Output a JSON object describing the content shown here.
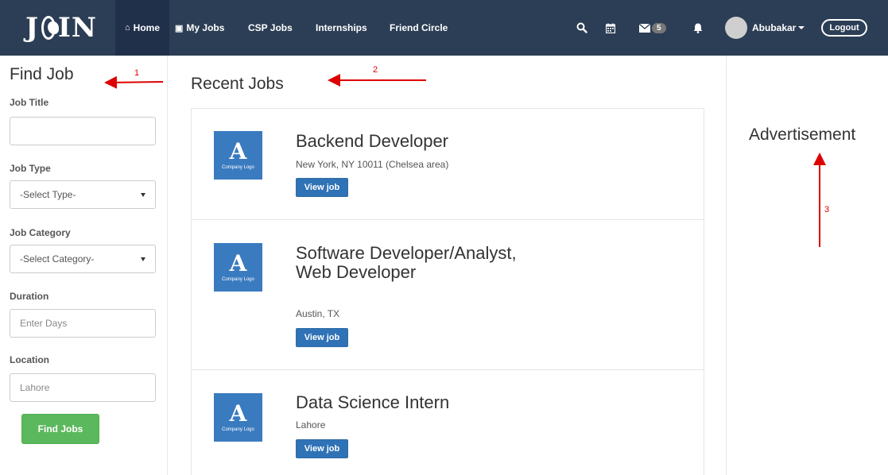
{
  "nav": {
    "logo_left": "J",
    "logo_right": "IN",
    "items": [
      {
        "label": "Home",
        "icon": "home-icon"
      },
      {
        "label": "My Jobs",
        "icon": "briefcase-icon"
      },
      {
        "label": "CSP Jobs"
      },
      {
        "label": "Internships"
      },
      {
        "label": "Friend Circle"
      }
    ],
    "message_count": "5",
    "username": "Abubakar",
    "logout_label": "Logout"
  },
  "sidebar": {
    "title": "Find Job",
    "job_title_label": "Job Title",
    "job_type_label": "Job Type",
    "job_type_value": "-Select Type-",
    "job_category_label": "Job Category",
    "job_category_value": "-Select Category-",
    "duration_label": "Duration",
    "duration_placeholder": "Enter Days",
    "location_label": "Location",
    "location_value": "Lahore",
    "find_button": "Find Jobs"
  },
  "main": {
    "title": "Recent Jobs",
    "jobs": [
      {
        "title": "Backend Developer",
        "location": "New York, NY 10011 (Chelsea area)",
        "button": "View job",
        "logo_letter": "A",
        "logo_caption": "Company Logo"
      },
      {
        "title": "Software Developer/Analyst, Web Developer",
        "location": "Austin, TX",
        "button": "View job",
        "logo_letter": "A",
        "logo_caption": "Company Logo"
      },
      {
        "title": "Data Science Intern",
        "location": "Lahore",
        "button": "View job",
        "logo_letter": "A",
        "logo_caption": "Company Logo"
      }
    ]
  },
  "right": {
    "title": "Advertisement"
  },
  "annotations": {
    "one": "1",
    "two": "2",
    "three": "3"
  },
  "colors": {
    "navbar": "#2c3e55",
    "find_button": "#5cb85c",
    "view_button": "#2f72b6",
    "logo_tile": "#3a7bbf",
    "annotation": "#dd0000"
  }
}
